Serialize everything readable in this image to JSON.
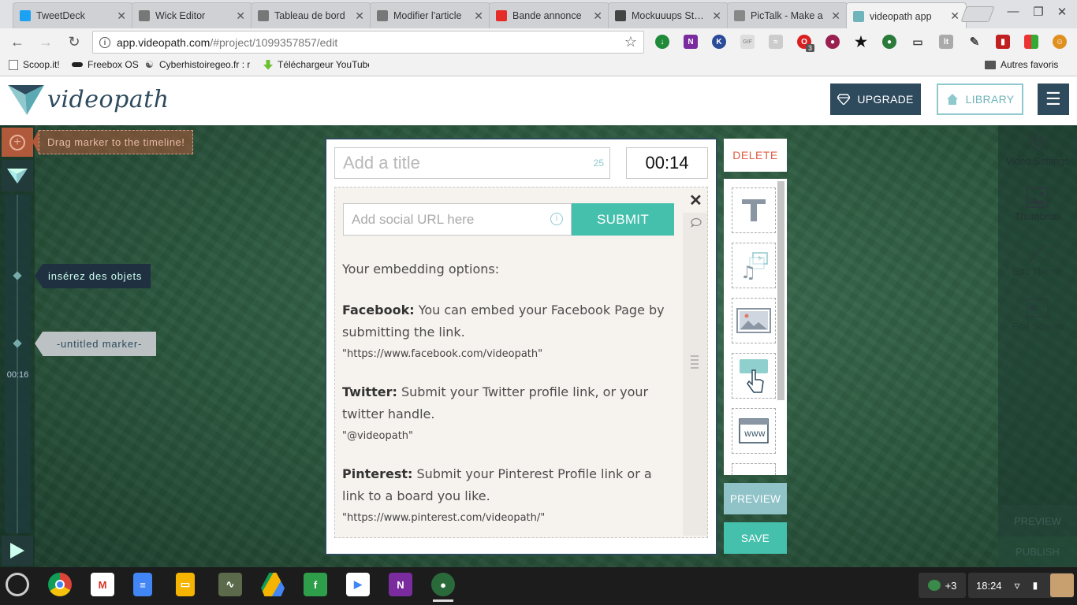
{
  "browser": {
    "tabs": [
      {
        "title": "TweetDeck",
        "icon": "twitter-icon",
        "color": "#1da1f2"
      },
      {
        "title": "Wick Editor",
        "icon": "chat-icon",
        "color": "#777777"
      },
      {
        "title": "Tableau de bord",
        "icon": "page-icon",
        "color": "#777777"
      },
      {
        "title": "Modifier l'article",
        "icon": "page-icon",
        "color": "#777777"
      },
      {
        "title": "Bande annonce",
        "icon": "youtube-icon",
        "color": "#e52d27"
      },
      {
        "title": "Mockuuups Studio",
        "icon": "m-icon",
        "color": "#444444"
      },
      {
        "title": "PicTalk - Make a",
        "icon": "pictalk-icon",
        "color": "#888888"
      },
      {
        "title": "videopath app",
        "icon": "videopath-icon",
        "color": "#6fb5bb"
      }
    ],
    "url_domain": "app.videopath.com",
    "url_path": "/#project/1099357857/edit",
    "bookmarks": [
      "Scoop.it!",
      "Freebox OS",
      "Cyberhistoiregeo.fr : r",
      "Téléchargeur YouTube"
    ],
    "other_bookmarks": "Autres favoris",
    "ext_badge": "3"
  },
  "app": {
    "logo_text": "videopath",
    "upgrade_label": "UPGRADE",
    "library_label": "LIBRARY",
    "brand_color": "#2e4a5d",
    "accent_color": "#45c0ad"
  },
  "timeline": {
    "drag_hint": "Drag marker to the timeline!",
    "markers": [
      "insérez des objets",
      "-untitled marker-"
    ],
    "timestamp": "00:16"
  },
  "right_panel": {
    "items": [
      "Video Settings",
      "Thumbnail",
      "Edit Theme",
      "End Screen"
    ],
    "preview": "PREVIEW",
    "publish": "PUBLISH"
  },
  "editor": {
    "title_placeholder": "Add a title",
    "title_char_count": "25",
    "time": "00:14",
    "url_placeholder": "Add social URL here",
    "submit_label": "SUBMIT",
    "embed_intro": "Your embedding options:",
    "options": [
      {
        "name": "Facebook:",
        "text": " You can embed your Facebook Page by submitting the link.",
        "example": "\"https://www.facebook.com/videopath\""
      },
      {
        "name": "Twitter:",
        "text": " Submit your Twitter profile link, or your twitter handle.",
        "example": "\"@videopath\""
      },
      {
        "name": "Pinterest:",
        "text": " Submit your Pinterest Profile link or a link to a board you like.",
        "example": "\"https://www.pinterest.com/videopath/\""
      }
    ]
  },
  "palette": {
    "delete_label": "DELETE",
    "tools": [
      "text-tool-icon",
      "media-tool-icon",
      "image-tool-icon",
      "button-tool-icon",
      "website-tool-icon"
    ],
    "preview_label": "PREVIEW",
    "save_label": "SAVE"
  },
  "taskbar": {
    "tray_count": "+3",
    "clock": "18:24"
  }
}
